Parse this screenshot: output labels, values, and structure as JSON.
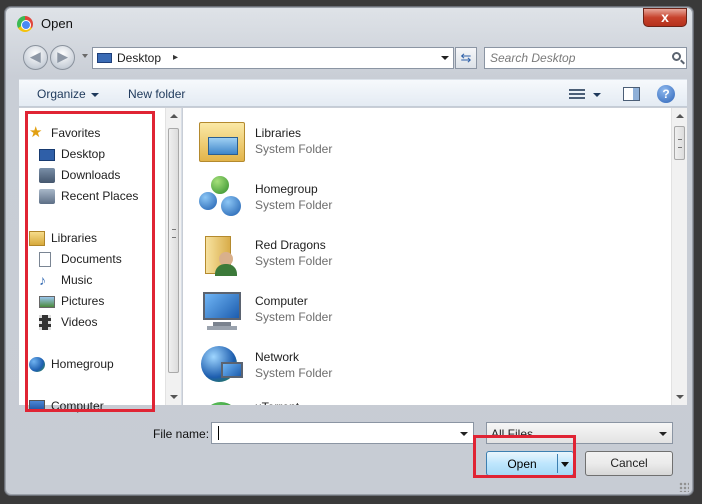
{
  "window": {
    "title": "Open",
    "close_label": "x"
  },
  "nav": {
    "address": "Desktop",
    "address_separator": "▸",
    "search_placeholder": "Search Desktop"
  },
  "toolbar": {
    "organize_label": "Organize",
    "new_folder_label": "New folder",
    "help_label": "?"
  },
  "sidebar": {
    "items": [
      {
        "label": "Favorites",
        "icon": "star-icon"
      },
      {
        "label": "Desktop",
        "icon": "desktop-icon"
      },
      {
        "label": "Downloads",
        "icon": "downloads-icon"
      },
      {
        "label": "Recent Places",
        "icon": "recent-places-icon"
      },
      {
        "label": "Libraries",
        "icon": "libraries-icon"
      },
      {
        "label": "Documents",
        "icon": "documents-icon"
      },
      {
        "label": "Music",
        "icon": "music-icon"
      },
      {
        "label": "Pictures",
        "icon": "pictures-icon"
      },
      {
        "label": "Videos",
        "icon": "videos-icon"
      },
      {
        "label": "Homegroup",
        "icon": "homegroup-icon"
      },
      {
        "label": "Computer",
        "icon": "computer-icon"
      }
    ]
  },
  "files": [
    {
      "name": "Libraries",
      "type": "System Folder",
      "icon": "libraries-folder-icon"
    },
    {
      "name": "Homegroup",
      "type": "System Folder",
      "icon": "homegroup-icon"
    },
    {
      "name": "Red Dragons",
      "type": "System Folder",
      "icon": "user-folder-icon"
    },
    {
      "name": "Computer",
      "type": "System Folder",
      "icon": "computer-icon"
    },
    {
      "name": "Network",
      "type": "System Folder",
      "icon": "network-icon"
    },
    {
      "name": "uTorrent",
      "type": "",
      "icon": "utorrent-icon"
    }
  ],
  "footer": {
    "filename_label": "File name:",
    "filename_value": "",
    "filter_selected": "All Files",
    "open_label": "Open",
    "cancel_label": "Cancel"
  },
  "colors": {
    "highlight_box": "#e02434",
    "open_button": "#bee6fd"
  }
}
